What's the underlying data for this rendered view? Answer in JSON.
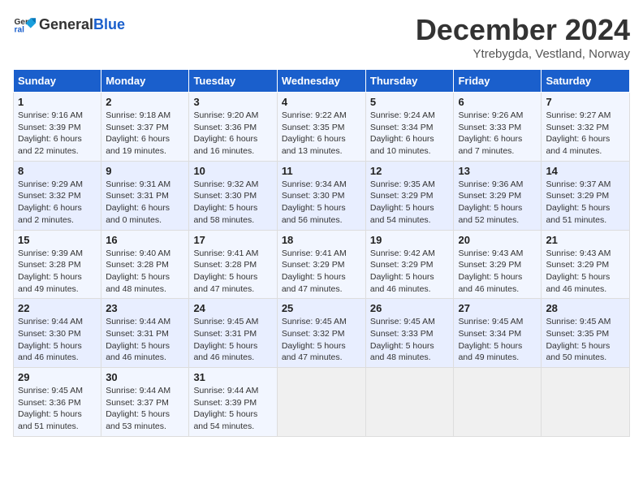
{
  "logo": {
    "text_general": "General",
    "text_blue": "Blue"
  },
  "header": {
    "month_title": "December 2024",
    "subtitle": "Ytrebygda, Vestland, Norway"
  },
  "weekdays": [
    "Sunday",
    "Monday",
    "Tuesday",
    "Wednesday",
    "Thursday",
    "Friday",
    "Saturday"
  ],
  "weeks": [
    [
      {
        "day": "1",
        "info": "Sunrise: 9:16 AM\nSunset: 3:39 PM\nDaylight: 6 hours\nand 22 minutes."
      },
      {
        "day": "2",
        "info": "Sunrise: 9:18 AM\nSunset: 3:37 PM\nDaylight: 6 hours\nand 19 minutes."
      },
      {
        "day": "3",
        "info": "Sunrise: 9:20 AM\nSunset: 3:36 PM\nDaylight: 6 hours\nand 16 minutes."
      },
      {
        "day": "4",
        "info": "Sunrise: 9:22 AM\nSunset: 3:35 PM\nDaylight: 6 hours\nand 13 minutes."
      },
      {
        "day": "5",
        "info": "Sunrise: 9:24 AM\nSunset: 3:34 PM\nDaylight: 6 hours\nand 10 minutes."
      },
      {
        "day": "6",
        "info": "Sunrise: 9:26 AM\nSunset: 3:33 PM\nDaylight: 6 hours\nand 7 minutes."
      },
      {
        "day": "7",
        "info": "Sunrise: 9:27 AM\nSunset: 3:32 PM\nDaylight: 6 hours\nand 4 minutes."
      }
    ],
    [
      {
        "day": "8",
        "info": "Sunrise: 9:29 AM\nSunset: 3:32 PM\nDaylight: 6 hours\nand 2 minutes."
      },
      {
        "day": "9",
        "info": "Sunrise: 9:31 AM\nSunset: 3:31 PM\nDaylight: 6 hours\nand 0 minutes."
      },
      {
        "day": "10",
        "info": "Sunrise: 9:32 AM\nSunset: 3:30 PM\nDaylight: 5 hours\nand 58 minutes."
      },
      {
        "day": "11",
        "info": "Sunrise: 9:34 AM\nSunset: 3:30 PM\nDaylight: 5 hours\nand 56 minutes."
      },
      {
        "day": "12",
        "info": "Sunrise: 9:35 AM\nSunset: 3:29 PM\nDaylight: 5 hours\nand 54 minutes."
      },
      {
        "day": "13",
        "info": "Sunrise: 9:36 AM\nSunset: 3:29 PM\nDaylight: 5 hours\nand 52 minutes."
      },
      {
        "day": "14",
        "info": "Sunrise: 9:37 AM\nSunset: 3:29 PM\nDaylight: 5 hours\nand 51 minutes."
      }
    ],
    [
      {
        "day": "15",
        "info": "Sunrise: 9:39 AM\nSunset: 3:28 PM\nDaylight: 5 hours\nand 49 minutes."
      },
      {
        "day": "16",
        "info": "Sunrise: 9:40 AM\nSunset: 3:28 PM\nDaylight: 5 hours\nand 48 minutes."
      },
      {
        "day": "17",
        "info": "Sunrise: 9:41 AM\nSunset: 3:28 PM\nDaylight: 5 hours\nand 47 minutes."
      },
      {
        "day": "18",
        "info": "Sunrise: 9:41 AM\nSunset: 3:29 PM\nDaylight: 5 hours\nand 47 minutes."
      },
      {
        "day": "19",
        "info": "Sunrise: 9:42 AM\nSunset: 3:29 PM\nDaylight: 5 hours\nand 46 minutes."
      },
      {
        "day": "20",
        "info": "Sunrise: 9:43 AM\nSunset: 3:29 PM\nDaylight: 5 hours\nand 46 minutes."
      },
      {
        "day": "21",
        "info": "Sunrise: 9:43 AM\nSunset: 3:29 PM\nDaylight: 5 hours\nand 46 minutes."
      }
    ],
    [
      {
        "day": "22",
        "info": "Sunrise: 9:44 AM\nSunset: 3:30 PM\nDaylight: 5 hours\nand 46 minutes."
      },
      {
        "day": "23",
        "info": "Sunrise: 9:44 AM\nSunset: 3:31 PM\nDaylight: 5 hours\nand 46 minutes."
      },
      {
        "day": "24",
        "info": "Sunrise: 9:45 AM\nSunset: 3:31 PM\nDaylight: 5 hours\nand 46 minutes."
      },
      {
        "day": "25",
        "info": "Sunrise: 9:45 AM\nSunset: 3:32 PM\nDaylight: 5 hours\nand 47 minutes."
      },
      {
        "day": "26",
        "info": "Sunrise: 9:45 AM\nSunset: 3:33 PM\nDaylight: 5 hours\nand 48 minutes."
      },
      {
        "day": "27",
        "info": "Sunrise: 9:45 AM\nSunset: 3:34 PM\nDaylight: 5 hours\nand 49 minutes."
      },
      {
        "day": "28",
        "info": "Sunrise: 9:45 AM\nSunset: 3:35 PM\nDaylight: 5 hours\nand 50 minutes."
      }
    ],
    [
      {
        "day": "29",
        "info": "Sunrise: 9:45 AM\nSunset: 3:36 PM\nDaylight: 5 hours\nand 51 minutes."
      },
      {
        "day": "30",
        "info": "Sunrise: 9:44 AM\nSunset: 3:37 PM\nDaylight: 5 hours\nand 53 minutes."
      },
      {
        "day": "31",
        "info": "Sunrise: 9:44 AM\nSunset: 3:39 PM\nDaylight: 5 hours\nand 54 minutes."
      },
      {
        "day": "",
        "info": ""
      },
      {
        "day": "",
        "info": ""
      },
      {
        "day": "",
        "info": ""
      },
      {
        "day": "",
        "info": ""
      }
    ]
  ]
}
